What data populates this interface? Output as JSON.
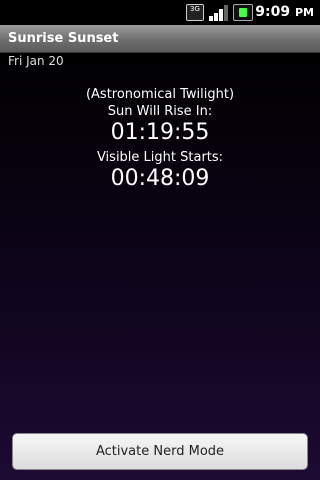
{
  "status_bar": {
    "network_type": "3G",
    "time": "9:09",
    "time_suffix": "PM"
  },
  "app": {
    "title": "Sunrise Sunset"
  },
  "main": {
    "date": "Fri Jan 20",
    "twilight_type": "(Astronomical Twilight)",
    "sun_rise_label": "Sun Will Rise In:",
    "sun_rise_countdown": "01:19:55",
    "visible_light_label": "Visible Light Starts:",
    "visible_light_countdown": "00:48:09"
  },
  "actions": {
    "nerd_mode_button": "Activate Nerd Mode"
  }
}
